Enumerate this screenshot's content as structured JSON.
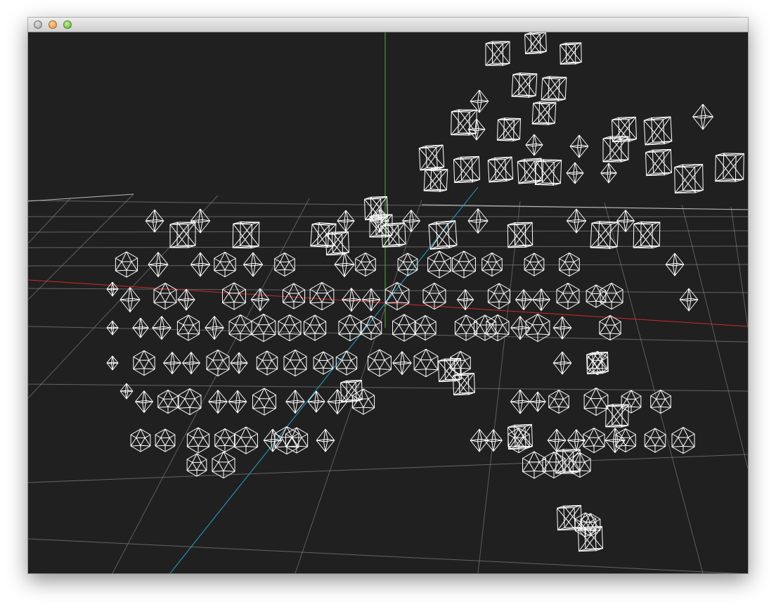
{
  "window": {
    "title": "",
    "buttons": [
      "close",
      "minimize",
      "zoom"
    ]
  },
  "scene": {
    "background_color": "#202020",
    "grid_color": "#9a9a9a",
    "wire_color": "#ffffff",
    "axis_colors": {
      "x": "#d02a2a",
      "y": "#4caf3a",
      "z": "#2aa0d0"
    },
    "primitives": [
      "cube",
      "octahedron",
      "icosahedron"
    ]
  }
}
